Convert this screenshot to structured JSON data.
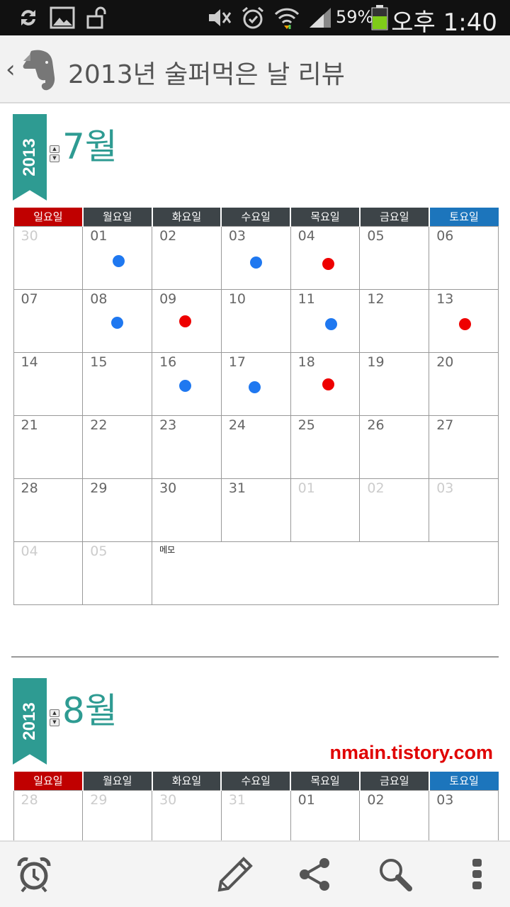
{
  "status_bar": {
    "battery_percent": "59%",
    "time": "오후 1:40",
    "icons": [
      "sync-icon",
      "gallery-icon",
      "unlock-icon",
      "mute-icon",
      "alarm-icon",
      "wifi-icon",
      "signal-icon",
      "battery-icon"
    ]
  },
  "action_bar": {
    "back": "‹",
    "title": "2013년 술퍼먹은 날 리뷰"
  },
  "calendar_july": {
    "year": "2013",
    "month": "7월",
    "weekdays": [
      "일요일",
      "월요일",
      "화요일",
      "수요일",
      "목요일",
      "금요일",
      "토요일"
    ],
    "rows": [
      [
        {
          "d": "30",
          "dim": true
        },
        {
          "d": "01",
          "dot": "blue"
        },
        {
          "d": "02"
        },
        {
          "d": "03",
          "dot": "blue"
        },
        {
          "d": "04",
          "dot": "red"
        },
        {
          "d": "05"
        },
        {
          "d": "06"
        }
      ],
      [
        {
          "d": "07"
        },
        {
          "d": "08",
          "dot": "blue"
        },
        {
          "d": "09",
          "dot": "red"
        },
        {
          "d": "10"
        },
        {
          "d": "11",
          "dot": "blue"
        },
        {
          "d": "12"
        },
        {
          "d": "13",
          "dot": "red"
        }
      ],
      [
        {
          "d": "14"
        },
        {
          "d": "15"
        },
        {
          "d": "16",
          "dot": "blue"
        },
        {
          "d": "17",
          "dot": "blue"
        },
        {
          "d": "18",
          "dot": "red"
        },
        {
          "d": "19"
        },
        {
          "d": "20"
        }
      ],
      [
        {
          "d": "21"
        },
        {
          "d": "22"
        },
        {
          "d": "23"
        },
        {
          "d": "24"
        },
        {
          "d": "25"
        },
        {
          "d": "26"
        },
        {
          "d": "27"
        }
      ],
      [
        {
          "d": "28"
        },
        {
          "d": "29"
        },
        {
          "d": "30"
        },
        {
          "d": "31"
        },
        {
          "d": "01",
          "dim": true
        },
        {
          "d": "02",
          "dim": true
        },
        {
          "d": "03",
          "dim": true
        }
      ],
      [
        {
          "d": "04",
          "dim": true
        },
        {
          "d": "05",
          "dim": true
        },
        {
          "memo": "메모"
        }
      ]
    ]
  },
  "calendar_august": {
    "year": "2013",
    "month": "8월",
    "weekdays": [
      "일요일",
      "월요일",
      "화요일",
      "수요일",
      "목요일",
      "금요일",
      "토요일"
    ],
    "rows": [
      [
        {
          "d": "28",
          "dim": true
        },
        {
          "d": "29",
          "dim": true
        },
        {
          "d": "30",
          "dim": true
        },
        {
          "d": "31",
          "dim": true
        },
        {
          "d": "01"
        },
        {
          "d": "02"
        },
        {
          "d": "03"
        }
      ]
    ]
  },
  "watermark": "nmain.tistory.com",
  "colors": {
    "teal": "#2e9b92",
    "sunday": "#c00000",
    "saturday": "#1c75bc",
    "blue_dot": "#1f78f0",
    "red_dot": "#ee0000"
  },
  "bottom_bar": {
    "icons": [
      "alarm-clock-icon",
      "pencil-icon",
      "share-icon",
      "search-icon",
      "more-vert-icon"
    ]
  }
}
